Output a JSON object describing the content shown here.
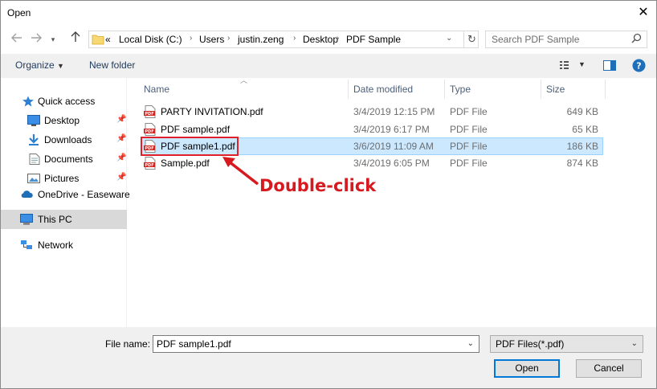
{
  "window": {
    "title": "Open",
    "close_glyph": "✕"
  },
  "nav": {
    "back_icon": "arrow-left-icon",
    "forward_icon": "arrow-right-icon",
    "dropdown_icon": "chevron-down-icon",
    "up_icon": "arrow-up-icon"
  },
  "address": {
    "overflow": "«",
    "crumbs": [
      "Local Disk (C:)",
      "Users",
      "justin.zeng",
      "Desktop",
      "PDF Sample"
    ]
  },
  "search": {
    "placeholder": "Search PDF Sample"
  },
  "toolbar": {
    "organize": "Organize",
    "new_folder": "New folder"
  },
  "sidebar": {
    "items": [
      {
        "label": "Quick access",
        "icon": "star-icon"
      },
      {
        "label": "Desktop",
        "icon": "desktop-icon",
        "pinned": true
      },
      {
        "label": "Downloads",
        "icon": "download-icon",
        "pinned": true
      },
      {
        "label": "Documents",
        "icon": "document-icon",
        "pinned": true
      },
      {
        "label": "Pictures",
        "icon": "pictures-icon",
        "pinned": true
      },
      {
        "label": "OneDrive - Easeware",
        "icon": "cloud-icon"
      },
      {
        "label": "This PC",
        "icon": "computer-icon",
        "selected": true
      },
      {
        "label": "Network",
        "icon": "network-icon"
      }
    ]
  },
  "columns": {
    "name": "Name",
    "date": "Date modified",
    "type": "Type",
    "size": "Size"
  },
  "files": [
    {
      "name": "PARTY INVITATION.pdf",
      "date": "3/4/2019 12:15 PM",
      "type": "PDF File",
      "size": "649 KB"
    },
    {
      "name": "PDF sample.pdf",
      "date": "3/4/2019 6:17 PM",
      "type": "PDF File",
      "size": "65 KB"
    },
    {
      "name": "PDF sample1.pdf",
      "date": "3/6/2019 11:09 AM",
      "type": "PDF File",
      "size": "186 KB",
      "selected": true
    },
    {
      "name": "Sample.pdf",
      "date": "3/4/2019 6:05 PM",
      "type": "PDF File",
      "size": "874 KB"
    }
  ],
  "annotation": {
    "text": "Double-click",
    "color": "#d71920"
  },
  "footer": {
    "file_name_label": "File name:",
    "file_name_value": "PDF sample1.pdf",
    "filter": "PDF Files(*.pdf)",
    "open": "Open",
    "cancel": "Cancel"
  },
  "colors": {
    "accent": "#0078d7",
    "selection": "#cce8ff",
    "highlight": "#e0202a"
  }
}
